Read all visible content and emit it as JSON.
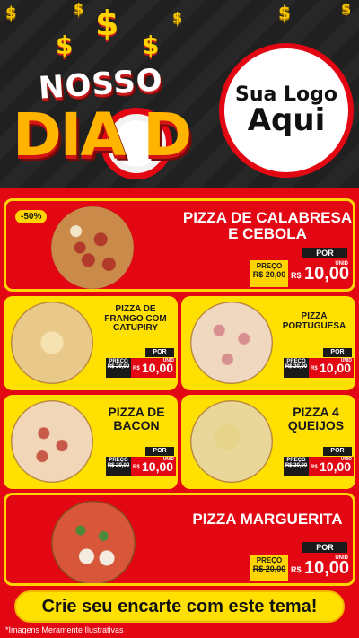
{
  "header": {
    "title_top": "NOSSO",
    "title_bottom": "DIA D",
    "logo_line1": "Sua Logo",
    "logo_line2": "Aqui"
  },
  "cards": [
    {
      "name": "PIZZA DE CALABRESA E CEBOLA",
      "badge": "-50%",
      "preco_label": "PREÇO",
      "old_price": "R$ 20,00",
      "por_label": "POR",
      "unid_label": "UNID",
      "currency": "R$",
      "price": "10,00"
    },
    {
      "name": "PIZZA DE FRANGO COM CATUPIRY",
      "preco_label": "PREÇO",
      "old_price": "R$ 20,00",
      "por_label": "POR",
      "unid_label": "UNID",
      "currency": "R$",
      "price": "10,00"
    },
    {
      "name": "PIZZA PORTUGUESA",
      "preco_label": "PREÇO",
      "old_price": "R$ 20,00",
      "por_label": "POR",
      "unid_label": "UNID",
      "currency": "R$",
      "price": "10,00"
    },
    {
      "name": "PIZZA DE BACON",
      "preco_label": "PREÇO",
      "old_price": "R$ 20,00",
      "por_label": "POR",
      "unid_label": "UNID",
      "currency": "R$",
      "price": "10,00"
    },
    {
      "name": "PIZZA 4 QUEIJOS",
      "preco_label": "PREÇO",
      "old_price": "R$ 20,00",
      "por_label": "POR",
      "unid_label": "UNID",
      "currency": "R$",
      "price": "10,00"
    },
    {
      "name": "PIZZA MARGUERITA",
      "preco_label": "PREÇO",
      "old_price": "R$ 20,00",
      "por_label": "POR",
      "unid_label": "UNID",
      "currency": "R$",
      "price": "10,00"
    }
  ],
  "footer": {
    "cta": "Crie seu encarte com este tema!",
    "note": "*Imagens Meramente Ilustrativas"
  },
  "colors": {
    "red": "#e30613",
    "yellow": "#ffe000",
    "dark": "#1a1a1a"
  }
}
